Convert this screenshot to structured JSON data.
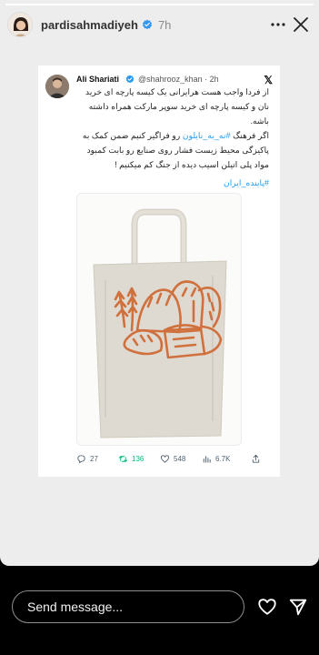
{
  "story": {
    "username": "pardisahmadiyeh",
    "time": "7h",
    "progress": 1.0
  },
  "tweet": {
    "author_name": "Ali Shariati",
    "handle": "@shahrooz_khan · 2h",
    "lines": [
      "از فردا واجب هست هرایرانی یک کیسه پارچه ای خرید",
      "نان و کیسه پارچه ای خرید سوپر مارکت همراه داشته",
      "باشه."
    ],
    "line2_prefix": "اگر فرهنگ ",
    "line2_hashtag": "#نه_به_نایلون",
    "line2_suffix": " رو فراگیر کنیم ضمن کمک به",
    "line3": "پاکیزگی محیط زیست فشار روی صنایع رو بابت کمبود",
    "line4": "مواد پلی اتیلن اسیب دیده از جنگ کم میکنیم !",
    "hashtag": "#پاینده_ایران",
    "stats": {
      "replies": "27",
      "reposts": "136",
      "likes": "548",
      "views": "6.7K"
    }
  },
  "message": {
    "placeholder": "Send message..."
  },
  "icons": [
    "avatar",
    "verified-icon",
    "more-icon",
    "close-icon",
    "x-logo-icon",
    "reply-icon",
    "repost-icon",
    "like-icon",
    "views-icon",
    "share-icon",
    "heart-icon",
    "send-icon"
  ],
  "colors": {
    "story_bg": "#ededed",
    "link": "#1d9bf0",
    "repost": "#00ba7c",
    "bread_print": "#d0703c",
    "bag": "#dedad2"
  }
}
